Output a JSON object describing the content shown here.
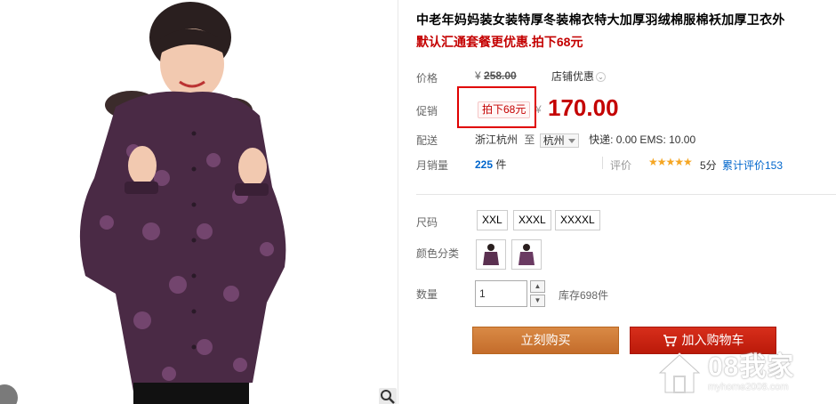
{
  "product": {
    "title": "中老年妈妈装女装特厚冬装棉衣特大加厚羽绒棉服棉袄加厚卫衣外",
    "subtitle": "默认汇通套餐更优惠.拍下68元"
  },
  "price": {
    "label": "价格",
    "currency": "¥",
    "original": "258.00",
    "store_discount": "店铺优惠"
  },
  "promo": {
    "label": "促销",
    "tag": "拍下68元",
    "currency": "¥",
    "price": "170.00"
  },
  "shipping": {
    "label": "配送",
    "from": "浙江杭州",
    "to_word": "至",
    "city": "杭州",
    "fees": "快递: 0.00 EMS: 10.00"
  },
  "sales": {
    "label": "月销量",
    "count": "225",
    "unit": "件",
    "rating_label": "评价",
    "stars": "★★★★★",
    "score": "5分",
    "review_link": "累计评价153"
  },
  "options": {
    "size_label": "尺码",
    "sizes": [
      "XXL",
      "XXXL",
      "XXXXL"
    ],
    "color_label": "颜色分类",
    "quantity_label": "数量",
    "quantity": "1",
    "stepper_up": "▲",
    "stepper_down": "▼",
    "stock": "库存698件"
  },
  "actions": {
    "buy_now": "立刻购买",
    "add_to_cart": "加入购物车"
  },
  "watermark": {
    "text": "08我家",
    "url": "myhome2008.com"
  },
  "colors": {
    "accent_red": "#c40000",
    "buy_button": "#c46c2b",
    "cart_button": "#bb1a0a",
    "link_blue": "#0066cc"
  }
}
